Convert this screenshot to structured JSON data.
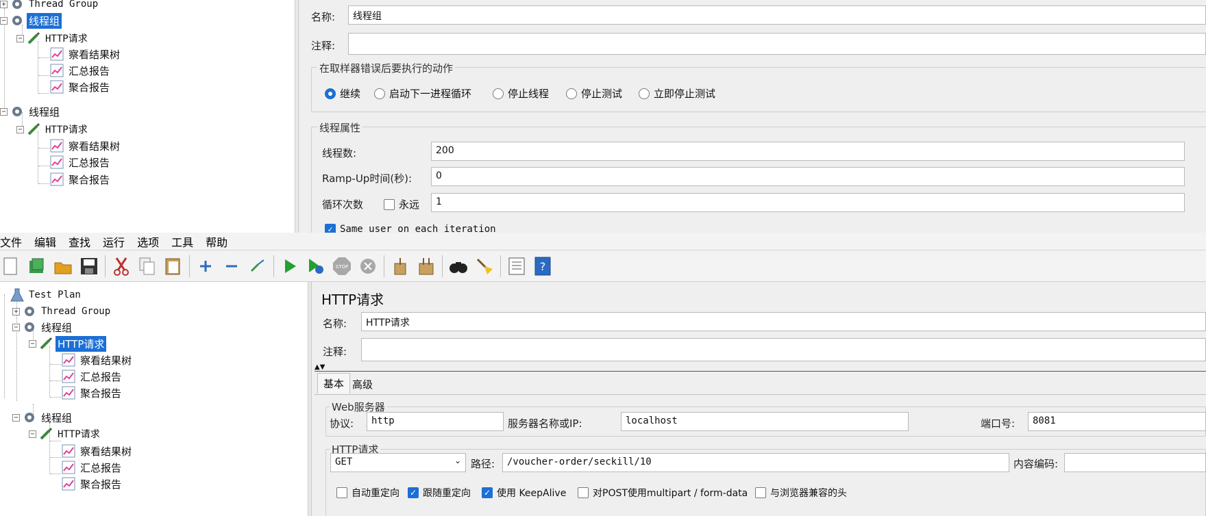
{
  "top": {
    "tree": {
      "items": [
        {
          "label": "Thread Group",
          "expander": "+"
        },
        {
          "label": "线程组",
          "expander": "−"
        },
        {
          "label": "HTTP请求",
          "expander": "−"
        },
        {
          "label": "察看结果树"
        },
        {
          "label": "汇总报告"
        },
        {
          "label": "聚合报告"
        },
        {
          "label": "线程组",
          "expander": "−"
        },
        {
          "label": "HTTP请求",
          "expander": "−"
        },
        {
          "label": "察看结果树"
        },
        {
          "label": "汇总报告"
        },
        {
          "label": "聚合报告"
        }
      ]
    },
    "panel": {
      "name_label": "名称:",
      "name_value": "线程组",
      "comment_label": "注释:",
      "comment_value": "",
      "error_group_title": "在取样器错误后要执行的动作",
      "error_options": [
        "继续",
        "启动下一进程循环",
        "停止线程",
        "停止测试",
        "立即停止测试"
      ],
      "error_selected": "继续",
      "thread_props_title": "线程属性",
      "threads_label": "线程数:",
      "threads_value": "200",
      "rampup_label": "Ramp-Up时间(秒):",
      "rampup_value": "0",
      "loop_label": "循环次数",
      "forever_label": "永远",
      "loop_value": "1",
      "same_user_label": "Same user on each iteration"
    }
  },
  "menubar": {
    "items": [
      "文件",
      "编辑",
      "查找",
      "运行",
      "选项",
      "工具",
      "帮助"
    ]
  },
  "toolbar": {
    "icons": [
      "new-icon",
      "templates-icon",
      "open-icon",
      "save-icon",
      "cut-icon",
      "copy-icon",
      "paste-icon",
      "expand-icon",
      "collapse-icon",
      "toggle-icon",
      "start-icon",
      "start-no-pause-icon",
      "stop-icon",
      "shutdown-icon",
      "clear-icon",
      "clear-all-icon",
      "search-icon",
      "reset-search-icon",
      "function-helper-icon",
      "help-icon"
    ]
  },
  "bottom": {
    "tree": {
      "items": [
        {
          "label": "Test Plan",
          "expander": "−"
        },
        {
          "label": "Thread Group",
          "expander": "+"
        },
        {
          "label": "线程组",
          "expander": "−"
        },
        {
          "label": "HTTP请求",
          "expander": "−"
        },
        {
          "label": "察看结果树"
        },
        {
          "label": "汇总报告"
        },
        {
          "label": "聚合报告"
        },
        {
          "label": "线程组",
          "expander": "−"
        },
        {
          "label": "HTTP请求",
          "expander": "−"
        },
        {
          "label": "察看结果树"
        },
        {
          "label": "汇总报告"
        },
        {
          "label": "聚合报告"
        }
      ]
    },
    "panel": {
      "title": "HTTP请求",
      "name_label": "名称:",
      "name_value": "HTTP请求",
      "comment_label": "注释:",
      "comment_value": "",
      "tabs": [
        "基本",
        "高级"
      ],
      "web_server_title": "Web服务器",
      "protocol_label": "协议:",
      "protocol_value": "http",
      "server_label": "服务器名称或IP:",
      "server_value": "localhost",
      "port_label": "端口号:",
      "port_value": "8081",
      "http_request_title": "HTTP请求",
      "method_value": "GET",
      "path_label": "路径:",
      "path_value": "/voucher-order/seckill/10",
      "encoding_label": "内容编码:",
      "encoding_value": "",
      "checkboxes": [
        {
          "label": "自动重定向",
          "checked": false
        },
        {
          "label": "跟随重定向",
          "checked": true
        },
        {
          "label": "使用 KeepAlive",
          "checked": true
        },
        {
          "label": "对POST使用multipart / form-data",
          "checked": false
        },
        {
          "label": "与浏览器兼容的头",
          "checked": false
        }
      ]
    }
  }
}
